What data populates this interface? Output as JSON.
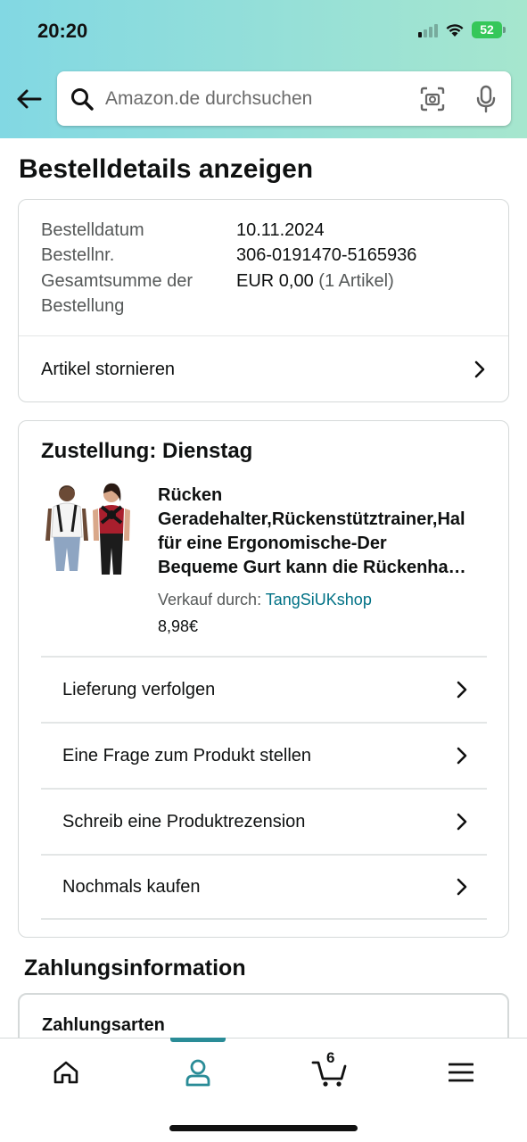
{
  "status_bar": {
    "time": "20:20",
    "battery": "52"
  },
  "search": {
    "placeholder": "Amazon.de durchsuchen"
  },
  "page_title": "Bestelldetails anzeigen",
  "order": {
    "date_label": "Bestelldatum",
    "date_value": "10.11.2024",
    "number_label": "Bestellnr.",
    "number_value": "306-0191470-5165936",
    "total_label_1": "Gesamtsumme der",
    "total_label_2": "Bestellung",
    "total_value": "EUR 0,00",
    "total_items": "(1 Artikel)",
    "cancel_label": "Artikel stornieren"
  },
  "delivery": {
    "title": "Zustellung: Dienstag",
    "product_title_lines": [
      "Rücken",
      "Geradehalter,Rückenstütztrainer,Hal",
      "für eine Ergonomische-Der",
      "Bequeme Gurt kann die Rückenha…"
    ],
    "seller_prefix": "Verkauf durch: ",
    "seller_name": "TangSiUKshop",
    "price": "8,98€",
    "actions": [
      {
        "label": "Lieferung verfolgen"
      },
      {
        "label": "Eine Frage zum Produkt stellen"
      },
      {
        "label": "Schreib eine Produktrezension"
      },
      {
        "label": "Nochmals kaufen"
      }
    ]
  },
  "payment": {
    "section_title": "Zahlungsinformation",
    "methods_label": "Zahlungsarten"
  },
  "bottom_nav": {
    "cart_count": "6",
    "items": [
      "home-icon",
      "account-icon",
      "cart-icon",
      "menu-icon"
    ],
    "active": "account-icon",
    "accent_color": "#2a8c97"
  }
}
